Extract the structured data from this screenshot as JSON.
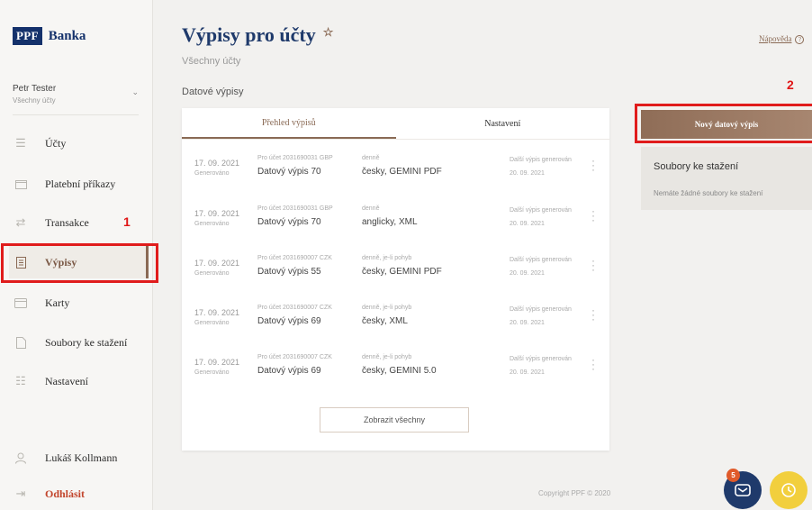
{
  "brand": {
    "logo_box": "PPF",
    "logo_text": "Banka"
  },
  "user": {
    "name": "Petr Tester",
    "scope": "Všechny účty"
  },
  "nav": [
    {
      "label": "Účty",
      "icon": "menu-lines-icon"
    },
    {
      "label": "Platební příkazy",
      "icon": "folder-icon"
    },
    {
      "label": "Transakce",
      "icon": "transfer-arrows-icon"
    },
    {
      "label": "Výpisy",
      "icon": "statement-icon"
    },
    {
      "label": "Karty",
      "icon": "card-icon"
    },
    {
      "label": "Soubory ke stažení",
      "icon": "document-icon"
    },
    {
      "label": "Nastavení",
      "icon": "settings-icon"
    }
  ],
  "account_user": {
    "label": "Lukáš Kollmann"
  },
  "logout": {
    "label": "Odhlásit"
  },
  "annotations": {
    "nav": "1",
    "button": "2"
  },
  "page": {
    "title": "Výpisy pro účty",
    "subtitle": "Všechny účty",
    "help": "Nápověda",
    "section": "Datové výpisy"
  },
  "tabs": [
    "Přehled výpisů",
    "Nastavení"
  ],
  "statements": [
    {
      "date": "17. 09. 2021",
      "status": "Generováno",
      "account": "Pro účet 2031690031 GBP",
      "name": "Datový výpis 70",
      "frequency": "denně",
      "format": "česky, GEMINI PDF",
      "next_label": "Další výpis generován",
      "next_date": "20. 09. 2021"
    },
    {
      "date": "17. 09. 2021",
      "status": "Generováno",
      "account": "Pro účet 2031690031 GBP",
      "name": "Datový výpis 70",
      "frequency": "denně",
      "format": "anglicky, XML",
      "next_label": "Další výpis generován",
      "next_date": "20. 09. 2021"
    },
    {
      "date": "17. 09. 2021",
      "status": "Generováno",
      "account": "Pro účet 2031690007 CZK",
      "name": "Datový výpis 55",
      "frequency": "denně, je-li pohyb",
      "format": "česky, GEMINI PDF",
      "next_label": "Další výpis generován",
      "next_date": "20. 09. 2021"
    },
    {
      "date": "17. 09. 2021",
      "status": "Generováno",
      "account": "Pro účet 2031690007 CZK",
      "name": "Datový výpis 69",
      "frequency": "denně, je-li pohyb",
      "format": "česky, XML",
      "next_label": "Další výpis generován",
      "next_date": "20. 09. 2021"
    },
    {
      "date": "17. 09. 2021",
      "status": "Generováno",
      "account": "Pro účet 2031690007 CZK",
      "name": "Datový výpis 69",
      "frequency": "denně, je-li pohyb",
      "format": "česky, GEMINI 5.0",
      "next_label": "Další výpis generován",
      "next_date": "20. 09. 2021"
    }
  ],
  "show_all": "Zobrazit všechny",
  "new_statement": "Nový datový výpis",
  "downloads": {
    "title": "Soubory ke stažení",
    "empty": "Nemáte žádné soubory ke stažení"
  },
  "footer": {
    "copyright": "Copyright PPF © 2020"
  },
  "notifications": {
    "count": "5"
  },
  "colors": {
    "brand_navy": "#1f3a6b",
    "accent_brown": "#8a6a55",
    "annotation_red": "#e01c1c",
    "fab_yellow": "#f2cf3d"
  }
}
